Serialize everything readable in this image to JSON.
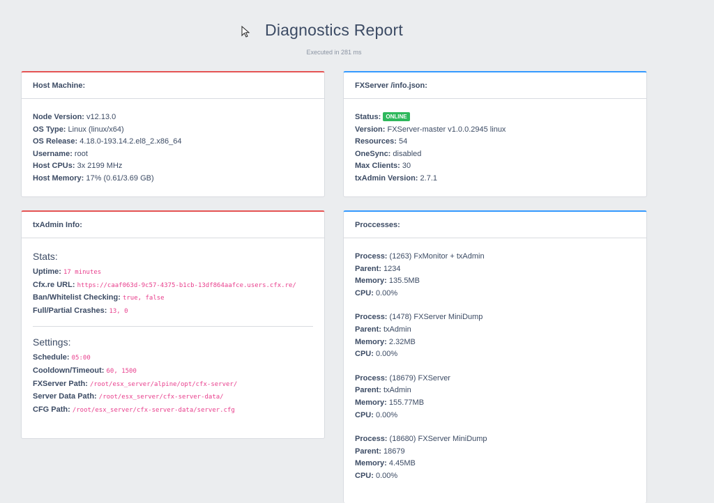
{
  "page": {
    "title": "Diagnostics Report",
    "subtitle": "Executed in 281 ms"
  },
  "host": {
    "header": "Host Machine:",
    "rows": [
      {
        "label": "Node Version:",
        "value": "v12.13.0"
      },
      {
        "label": "OS Type:",
        "value": "Linux (linux/x64)"
      },
      {
        "label": "OS Release:",
        "value": "4.18.0-193.14.2.el8_2.x86_64"
      },
      {
        "label": "Username:",
        "value": "root"
      },
      {
        "label": "Host CPUs:",
        "value": "3x 2199 MHz"
      },
      {
        "label": "Host Memory:",
        "value": "17% (0.61/3.69 GB)"
      }
    ]
  },
  "fxserver": {
    "header": "FXServer /info.json:",
    "status_label": "Status:",
    "status_badge": "ONLINE",
    "rows": [
      {
        "label": "Version:",
        "value": "FXServer-master v1.0.0.2945 linux"
      },
      {
        "label": "Resources:",
        "value": "54"
      },
      {
        "label": "OneSync:",
        "value": "disabled"
      },
      {
        "label": "Max Clients:",
        "value": "30"
      },
      {
        "label": "txAdmin Version:",
        "value": "2.7.1"
      }
    ]
  },
  "txadmin": {
    "header": "txAdmin Info:",
    "stats_title": "Stats:",
    "stats": [
      {
        "label": "Uptime:",
        "value": "17 minutes"
      },
      {
        "label": "Cfx.re URL:",
        "value": "https://caaf063d-9c57-4375-b1cb-13df864aafce.users.cfx.re/"
      },
      {
        "label": "Ban/Whitelist Checking:",
        "value": "true, false"
      },
      {
        "label": "Full/Partial Crashes:",
        "value": "13, 0"
      }
    ],
    "settings_title": "Settings:",
    "settings": [
      {
        "label": "Schedule:",
        "value": "05:00"
      },
      {
        "label": "Cooldown/Timeout:",
        "value": "60, 1500"
      },
      {
        "label": "FXServer Path:",
        "value": "/root/esx_server/alpine/opt/cfx-server/"
      },
      {
        "label": "Server Data Path:",
        "value": "/root/esx_server/cfx-server-data/"
      },
      {
        "label": "CFG Path:",
        "value": "/root/esx_server/cfx-server-data/server.cfg"
      }
    ]
  },
  "processes": {
    "header": "Proccesses:",
    "labels": {
      "process": "Process:",
      "parent": "Parent:",
      "memory": "Memory:",
      "cpu": "CPU:"
    },
    "items": [
      {
        "process": "(1263) FxMonitor + txAdmin",
        "parent": "1234",
        "memory": "135.5MB",
        "cpu": "0.00%"
      },
      {
        "process": "(1478) FXServer MiniDump",
        "parent": "txAdmin",
        "memory": "2.32MB",
        "cpu": "0.00%"
      },
      {
        "process": "(18679) FXServer",
        "parent": "txAdmin",
        "memory": "155.77MB",
        "cpu": "0.00%"
      },
      {
        "process": "(18680) FXServer MiniDump",
        "parent": "18679",
        "memory": "4.45MB",
        "cpu": "0.00%"
      }
    ]
  },
  "icons": {
    "cursor": "mouse-pointer-icon"
  },
  "colors": {
    "danger": "#e55353",
    "info": "#3399ff",
    "success": "#2eb85c",
    "code": "#e83e8c"
  }
}
